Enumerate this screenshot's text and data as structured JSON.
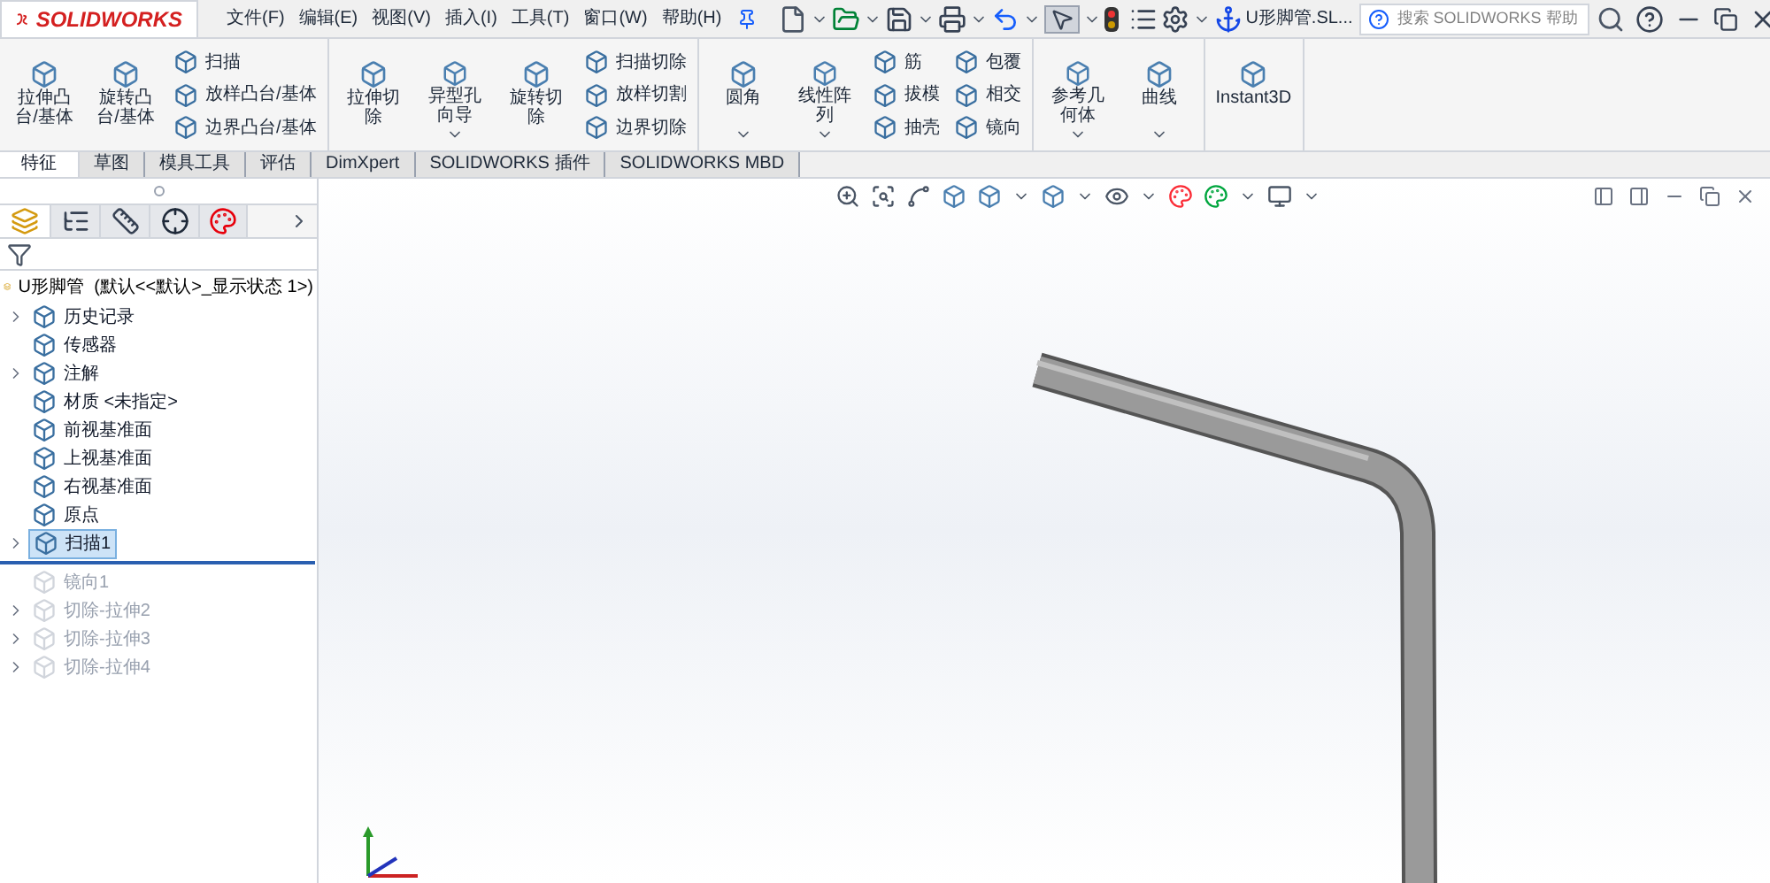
{
  "app": {
    "logo": "SOLIDWORKS",
    "title": "U形脚管.SL...",
    "search": {
      "placeholder": "搜索 SOLIDWORKS 帮助"
    }
  },
  "menus": [
    "文件(F)",
    "编辑(E)",
    "视图(V)",
    "插入(I)",
    "工具(T)",
    "窗口(W)",
    "帮助(H)"
  ],
  "ribbon": [
    {
      "commands": [
        {
          "kind": "large",
          "label": "拉伸凸台/基体",
          "dropdown": false
        },
        {
          "kind": "large",
          "label": "旋转凸台/基体",
          "dropdown": false
        }
      ],
      "smalls": [
        [
          "扫描",
          "放样凸台/基体",
          "边界凸台/基体"
        ]
      ]
    },
    {
      "commands": [
        {
          "kind": "large",
          "label": "拉伸切除",
          "dropdown": false
        },
        {
          "kind": "large",
          "label": "异型孔向导",
          "dropdown": true
        },
        {
          "kind": "large",
          "label": "旋转切除",
          "dropdown": false
        }
      ],
      "smalls": [
        [
          "扫描切除",
          "放样切割",
          "边界切除"
        ]
      ]
    },
    {
      "commands": [
        {
          "kind": "large",
          "label": "圆角",
          "dropdown": true
        },
        {
          "kind": "large",
          "label": "线性阵列",
          "dropdown": true
        }
      ],
      "smalls": [
        [
          "筋",
          "拔模",
          "抽壳"
        ],
        [
          "包覆",
          "相交",
          "镜向"
        ]
      ]
    },
    {
      "commands": [
        {
          "kind": "large",
          "label": "参考几何体",
          "dropdown": true
        },
        {
          "kind": "large",
          "label": "曲线",
          "dropdown": true
        }
      ]
    },
    {
      "commands": [
        {
          "kind": "large",
          "label": "Instant3D",
          "dropdown": false
        }
      ]
    }
  ],
  "tabs": [
    {
      "label": "特征",
      "selected": true
    },
    {
      "label": "草图",
      "selected": false
    },
    {
      "label": "模具工具",
      "selected": false
    },
    {
      "label": "评估",
      "selected": false
    },
    {
      "label": "DimXpert",
      "selected": false
    },
    {
      "label": "SOLIDWORKS 插件",
      "selected": false
    },
    {
      "label": "SOLIDWORKS MBD",
      "selected": false
    }
  ],
  "tree": {
    "root": "U形脚管  (默认<<默认>_显示状态 1>)",
    "items": [
      {
        "label": "历史记录",
        "expandable": true,
        "selected": false,
        "rolled_back": false
      },
      {
        "label": "传感器",
        "expandable": false,
        "selected": false,
        "rolled_back": false
      },
      {
        "label": "注解",
        "expandable": true,
        "selected": false,
        "rolled_back": false
      },
      {
        "label": "材质 <未指定>",
        "expandable": false,
        "selected": false,
        "rolled_back": false
      },
      {
        "label": "前视基准面",
        "expandable": false,
        "selected": false,
        "rolled_back": false
      },
      {
        "label": "上视基准面",
        "expandable": false,
        "selected": false,
        "rolled_back": false
      },
      {
        "label": "右视基准面",
        "expandable": false,
        "selected": false,
        "rolled_back": false
      },
      {
        "label": "原点",
        "expandable": false,
        "selected": false,
        "rolled_back": false
      },
      {
        "label": "扫描1",
        "expandable": true,
        "selected": true,
        "rolled_back": false
      },
      {
        "label": "镜向1",
        "expandable": false,
        "selected": false,
        "rolled_back": true
      },
      {
        "label": "切除-拉伸2",
        "expandable": true,
        "selected": false,
        "rolled_back": true
      },
      {
        "label": "切除-拉伸3",
        "expandable": true,
        "selected": false,
        "rolled_back": true
      },
      {
        "label": "切除-拉伸4",
        "expandable": true,
        "selected": false,
        "rolled_back": true
      }
    ]
  }
}
